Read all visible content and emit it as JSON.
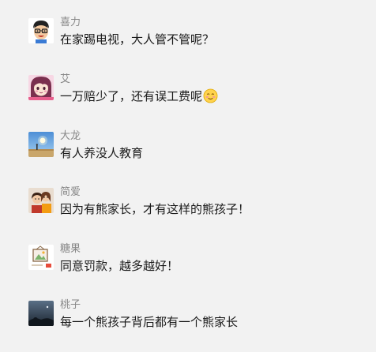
{
  "comments": [
    {
      "name": "喜力",
      "text": "在家踢电视，大人管不管呢？",
      "avatar_icon": "cartoon-boy-avatar"
    },
    {
      "name": "艾",
      "text": "一万赔少了，还有误工费呢",
      "avatar_icon": "anime-girl-avatar",
      "emoji": "blushing-smile-emoji"
    },
    {
      "name": "大龙",
      "text": "有人养没人教育",
      "avatar_icon": "sunrise-landscape-avatar"
    },
    {
      "name": "简爱",
      "text": "因为有熊家长，才有这样的熊孩子！",
      "avatar_icon": "couple-photo-avatar"
    },
    {
      "name": "糖果",
      "text": "同意罚款，越多越好！",
      "avatar_icon": "framed-picture-avatar"
    },
    {
      "name": "桃子",
      "text": "每一个熊孩子背后都有一个熊家长",
      "avatar_icon": "night-sky-avatar"
    }
  ],
  "colors": {
    "background": "#f2f2f2",
    "name": "#888888",
    "text": "#1a1a1a"
  }
}
